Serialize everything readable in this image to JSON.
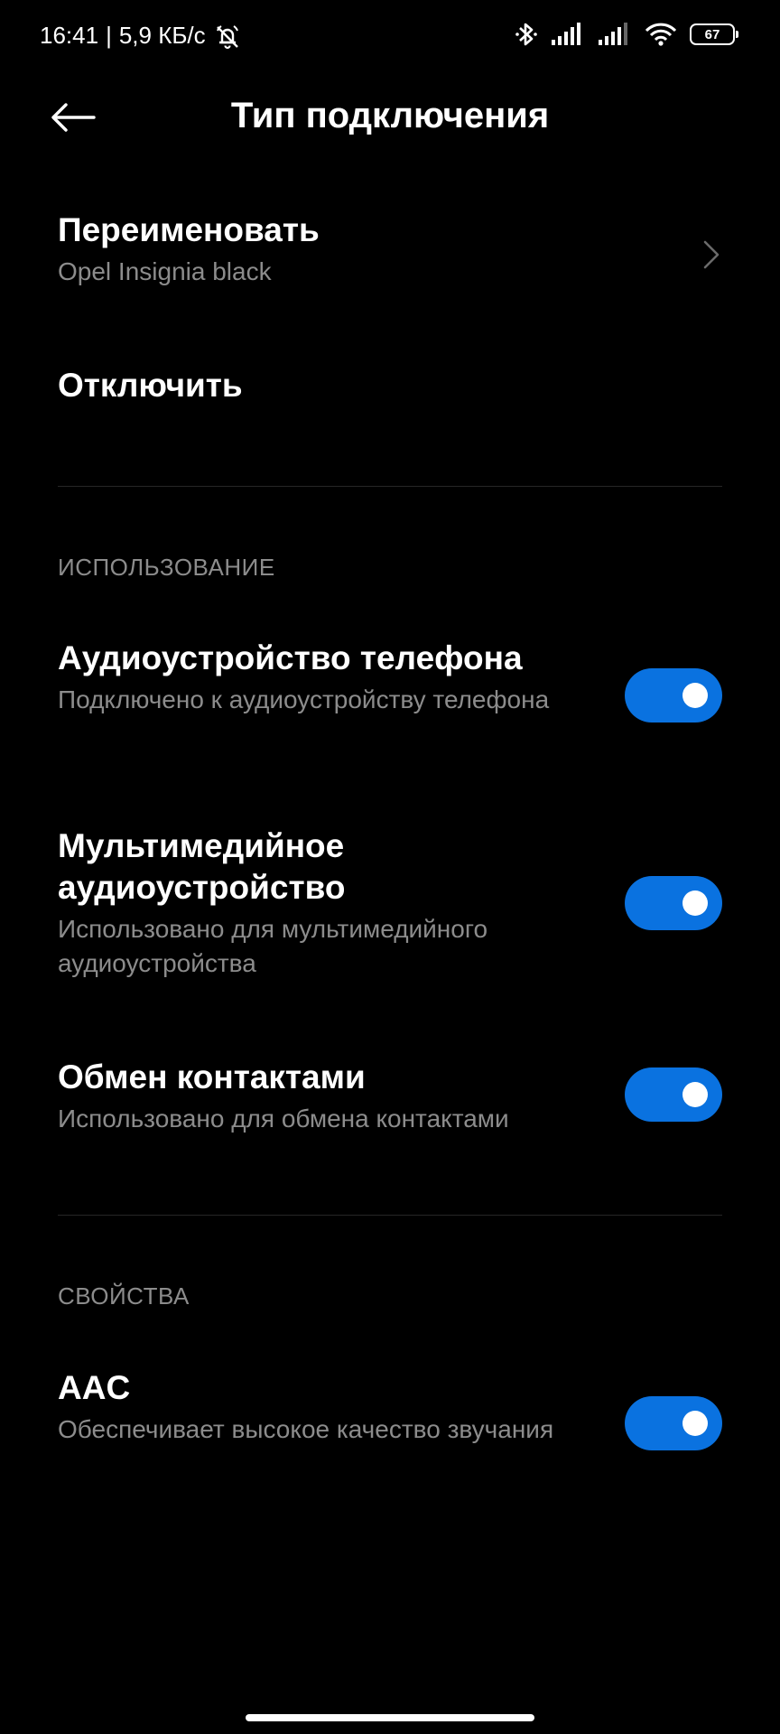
{
  "status_bar": {
    "time": "16:41",
    "separator": "|",
    "network_speed": "5,9 КБ/с",
    "icons": [
      "bell-off-icon",
      "bluetooth-icon",
      "signal-icon",
      "signal-icon",
      "wifi-icon"
    ],
    "battery_level": "67"
  },
  "header": {
    "back_icon": "arrow-left-icon",
    "title": "Тип подключения"
  },
  "device": {
    "rename_label": "Переименовать",
    "device_name": "Opel Insignia black",
    "disconnect_label": "Отключить"
  },
  "usage": {
    "section_label": "ИСПОЛЬЗОВАНИЕ",
    "items": [
      {
        "title": "Аудиоустройство телефона",
        "subtitle": "Подключено к аудиоустройству телефона",
        "enabled": true
      },
      {
        "title": "Мультимедийное аудиоустройство",
        "subtitle": "Использовано для мультимедийного аудиоустройства",
        "enabled": true
      },
      {
        "title": "Обмен контактами",
        "subtitle": "Использовано для обмена контактами",
        "enabled": true
      }
    ]
  },
  "properties": {
    "section_label": "СВОЙСТВА",
    "items": [
      {
        "title": "AAC",
        "subtitle": "Обеспечивает высокое качество звучания",
        "enabled": true
      }
    ]
  },
  "colors": {
    "background": "#000000",
    "accent": "#0a72e0",
    "secondary_text": "#8c8c8c"
  }
}
